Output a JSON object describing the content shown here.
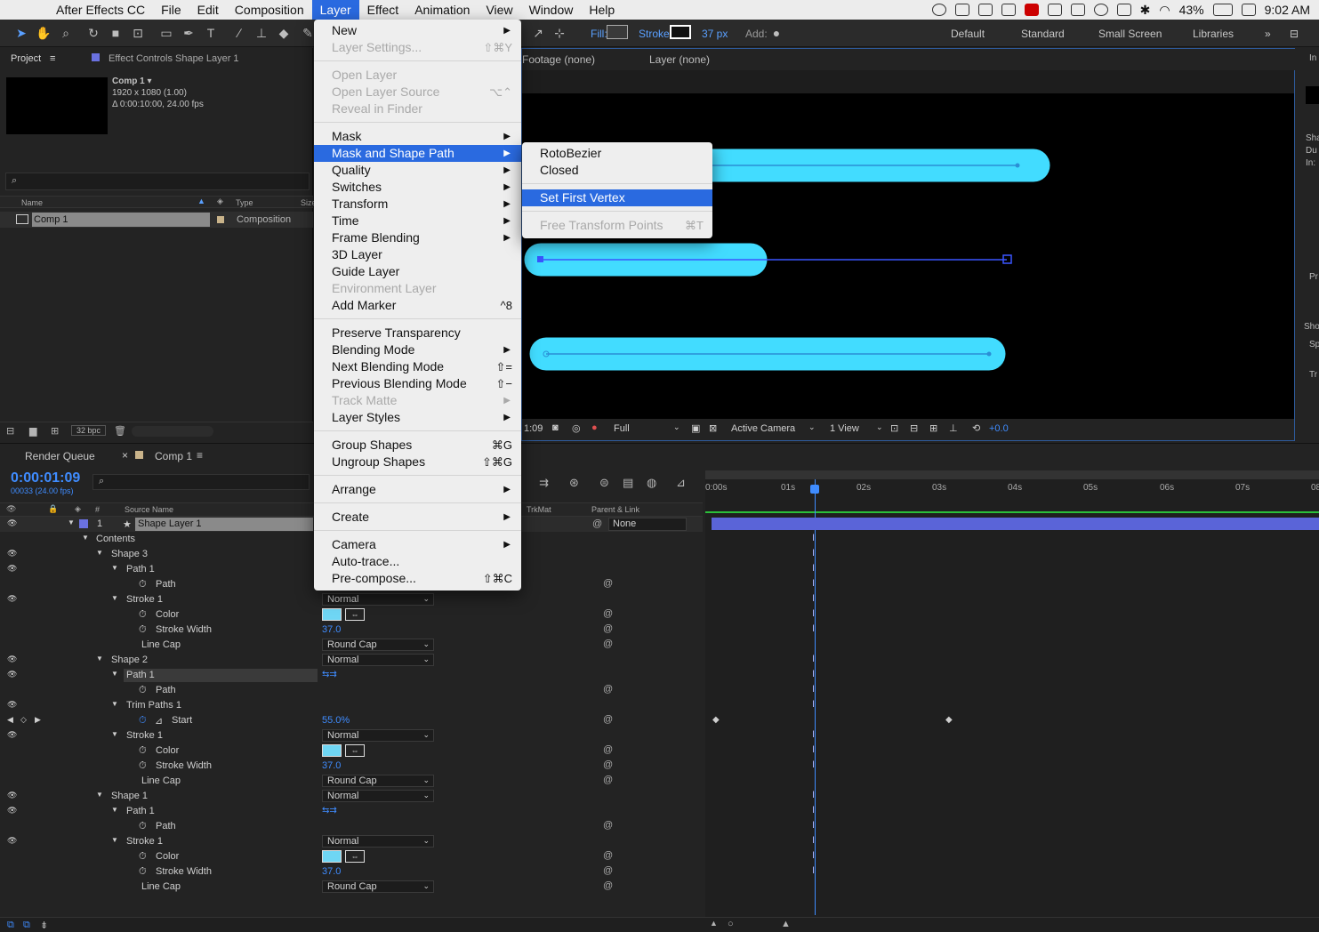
{
  "menubar": {
    "app_name": "After Effects CC",
    "items": [
      "File",
      "Edit",
      "Composition",
      "Layer",
      "Effect",
      "Animation",
      "View",
      "Window",
      "Help"
    ],
    "active": "Layer",
    "status": {
      "battery": "43%",
      "time": "9:02 AM"
    }
  },
  "toolbar": {
    "fill_label": "Fill:",
    "stroke_label": "Stroke:",
    "stroke_width": "37 px",
    "add_label": "Add:",
    "workspaces": [
      "Default",
      "Standard",
      "Small Screen",
      "Libraries"
    ]
  },
  "project": {
    "tab": "Project",
    "effect_controls_tab": "Effect Controls Shape Layer 1",
    "comp_name": "Comp 1 ▾",
    "comp_size": "1920 x 1080 (1.00)",
    "comp_duration": "Δ 0:00:10:00, 24.00 fps",
    "columns": {
      "name": "Name",
      "type": "Type",
      "size": "Size"
    },
    "item": {
      "name": "Comp 1",
      "type": "Composition"
    },
    "bpc": "32 bpc"
  },
  "viewer": {
    "tabs": [
      "Footage (none)",
      "Layer (none)"
    ],
    "time": "1:09",
    "resolution": "Full",
    "camera": "Active Camera",
    "views": "1 View",
    "exposure": "+0.0"
  },
  "right_panel": {
    "labels": [
      "In",
      "Sha",
      "Du",
      "In:",
      "Pr",
      "Sho",
      "Sp",
      "Tr"
    ]
  },
  "timeline": {
    "render_queue_tab": "Render Queue",
    "comp_tab": "Comp 1",
    "timecode": "0:00:01:09",
    "timecode_sub": "00033 (24.00 fps)",
    "columns": {
      "num": "#",
      "source": "Source Name",
      "trkmat": "TrkMat",
      "parent": "Parent & Link"
    },
    "ruler": [
      "0:00s",
      "01s",
      "02s",
      "03s",
      "04s",
      "05s",
      "06s",
      "07s",
      "08"
    ],
    "layer": {
      "num": "1",
      "name": "Shape Layer 1",
      "parent": "None"
    },
    "rows": [
      {
        "label": "Contents"
      },
      {
        "label": "Shape 3"
      },
      {
        "label": "Path 1"
      },
      {
        "label": "Path"
      },
      {
        "label": "Stroke 1",
        "value": "Normal"
      },
      {
        "label": "Color"
      },
      {
        "label": "Stroke Width",
        "value": "37.0"
      },
      {
        "label": "Line Cap",
        "value": "Round Cap"
      },
      {
        "label": "Shape 2",
        "value": "Normal"
      },
      {
        "label": "Path 1"
      },
      {
        "label": "Path"
      },
      {
        "label": "Trim Paths 1"
      },
      {
        "label": "Start",
        "value": "55.0%"
      },
      {
        "label": "Stroke 1",
        "value": "Normal"
      },
      {
        "label": "Color"
      },
      {
        "label": "Stroke Width",
        "value": "37.0"
      },
      {
        "label": "Line Cap",
        "value": "Round Cap"
      },
      {
        "label": "Shape 1",
        "value": "Normal"
      },
      {
        "label": "Path 1"
      },
      {
        "label": "Path"
      },
      {
        "label": "Stroke 1",
        "value": "Normal"
      },
      {
        "label": "Color"
      },
      {
        "label": "Stroke Width",
        "value": "37.0"
      },
      {
        "label": "Line Cap",
        "value": "Round Cap"
      }
    ]
  },
  "layer_menu": {
    "items": [
      {
        "label": "New",
        "arrow": true
      },
      {
        "label": "Layer Settings...",
        "shortcut": "⇧⌘Y",
        "disabled": true
      },
      {
        "label": "Open Layer",
        "disabled": true
      },
      {
        "label": "Open Layer Source",
        "shortcut": "⌥⌃",
        "disabled": true
      },
      {
        "label": "Reveal in Finder",
        "disabled": true
      },
      {
        "label": "Mask",
        "arrow": true
      },
      {
        "label": "Mask and Shape Path",
        "arrow": true,
        "highlighted": true
      },
      {
        "label": "Quality",
        "arrow": true
      },
      {
        "label": "Switches",
        "arrow": true
      },
      {
        "label": "Transform",
        "arrow": true
      },
      {
        "label": "Time",
        "arrow": true
      },
      {
        "label": "Frame Blending",
        "arrow": true
      },
      {
        "label": "3D Layer"
      },
      {
        "label": "Guide Layer"
      },
      {
        "label": "Environment Layer",
        "disabled": true
      },
      {
        "label": "Add Marker",
        "shortcut": "^8"
      },
      {
        "label": "Preserve Transparency"
      },
      {
        "label": "Blending Mode",
        "arrow": true
      },
      {
        "label": "Next Blending Mode",
        "shortcut": "⇧="
      },
      {
        "label": "Previous Blending Mode",
        "shortcut": "⇧−"
      },
      {
        "label": "Track Matte",
        "arrow": true,
        "disabled": true
      },
      {
        "label": "Layer Styles",
        "arrow": true
      },
      {
        "label": "Group Shapes",
        "shortcut": "⌘G"
      },
      {
        "label": "Ungroup Shapes",
        "shortcut": "⇧⌘G"
      },
      {
        "label": "Arrange",
        "arrow": true
      },
      {
        "label": "Create",
        "arrow": true
      },
      {
        "label": "Camera",
        "arrow": true
      },
      {
        "label": "Auto-trace..."
      },
      {
        "label": "Pre-compose...",
        "shortcut": "⇧⌘C"
      }
    ]
  },
  "submenu": {
    "items": [
      {
        "label": "RotoBezier"
      },
      {
        "label": "Closed"
      },
      {
        "label": "Set First Vertex",
        "highlighted": true
      },
      {
        "label": "Free Transform Points",
        "shortcut": "⌘T",
        "disabled": true
      }
    ]
  },
  "colors": {
    "accent": "#2a6ae0",
    "shape": "#42dcff",
    "timecode": "#3f8cff",
    "layer_bar": "#5a64d8"
  }
}
